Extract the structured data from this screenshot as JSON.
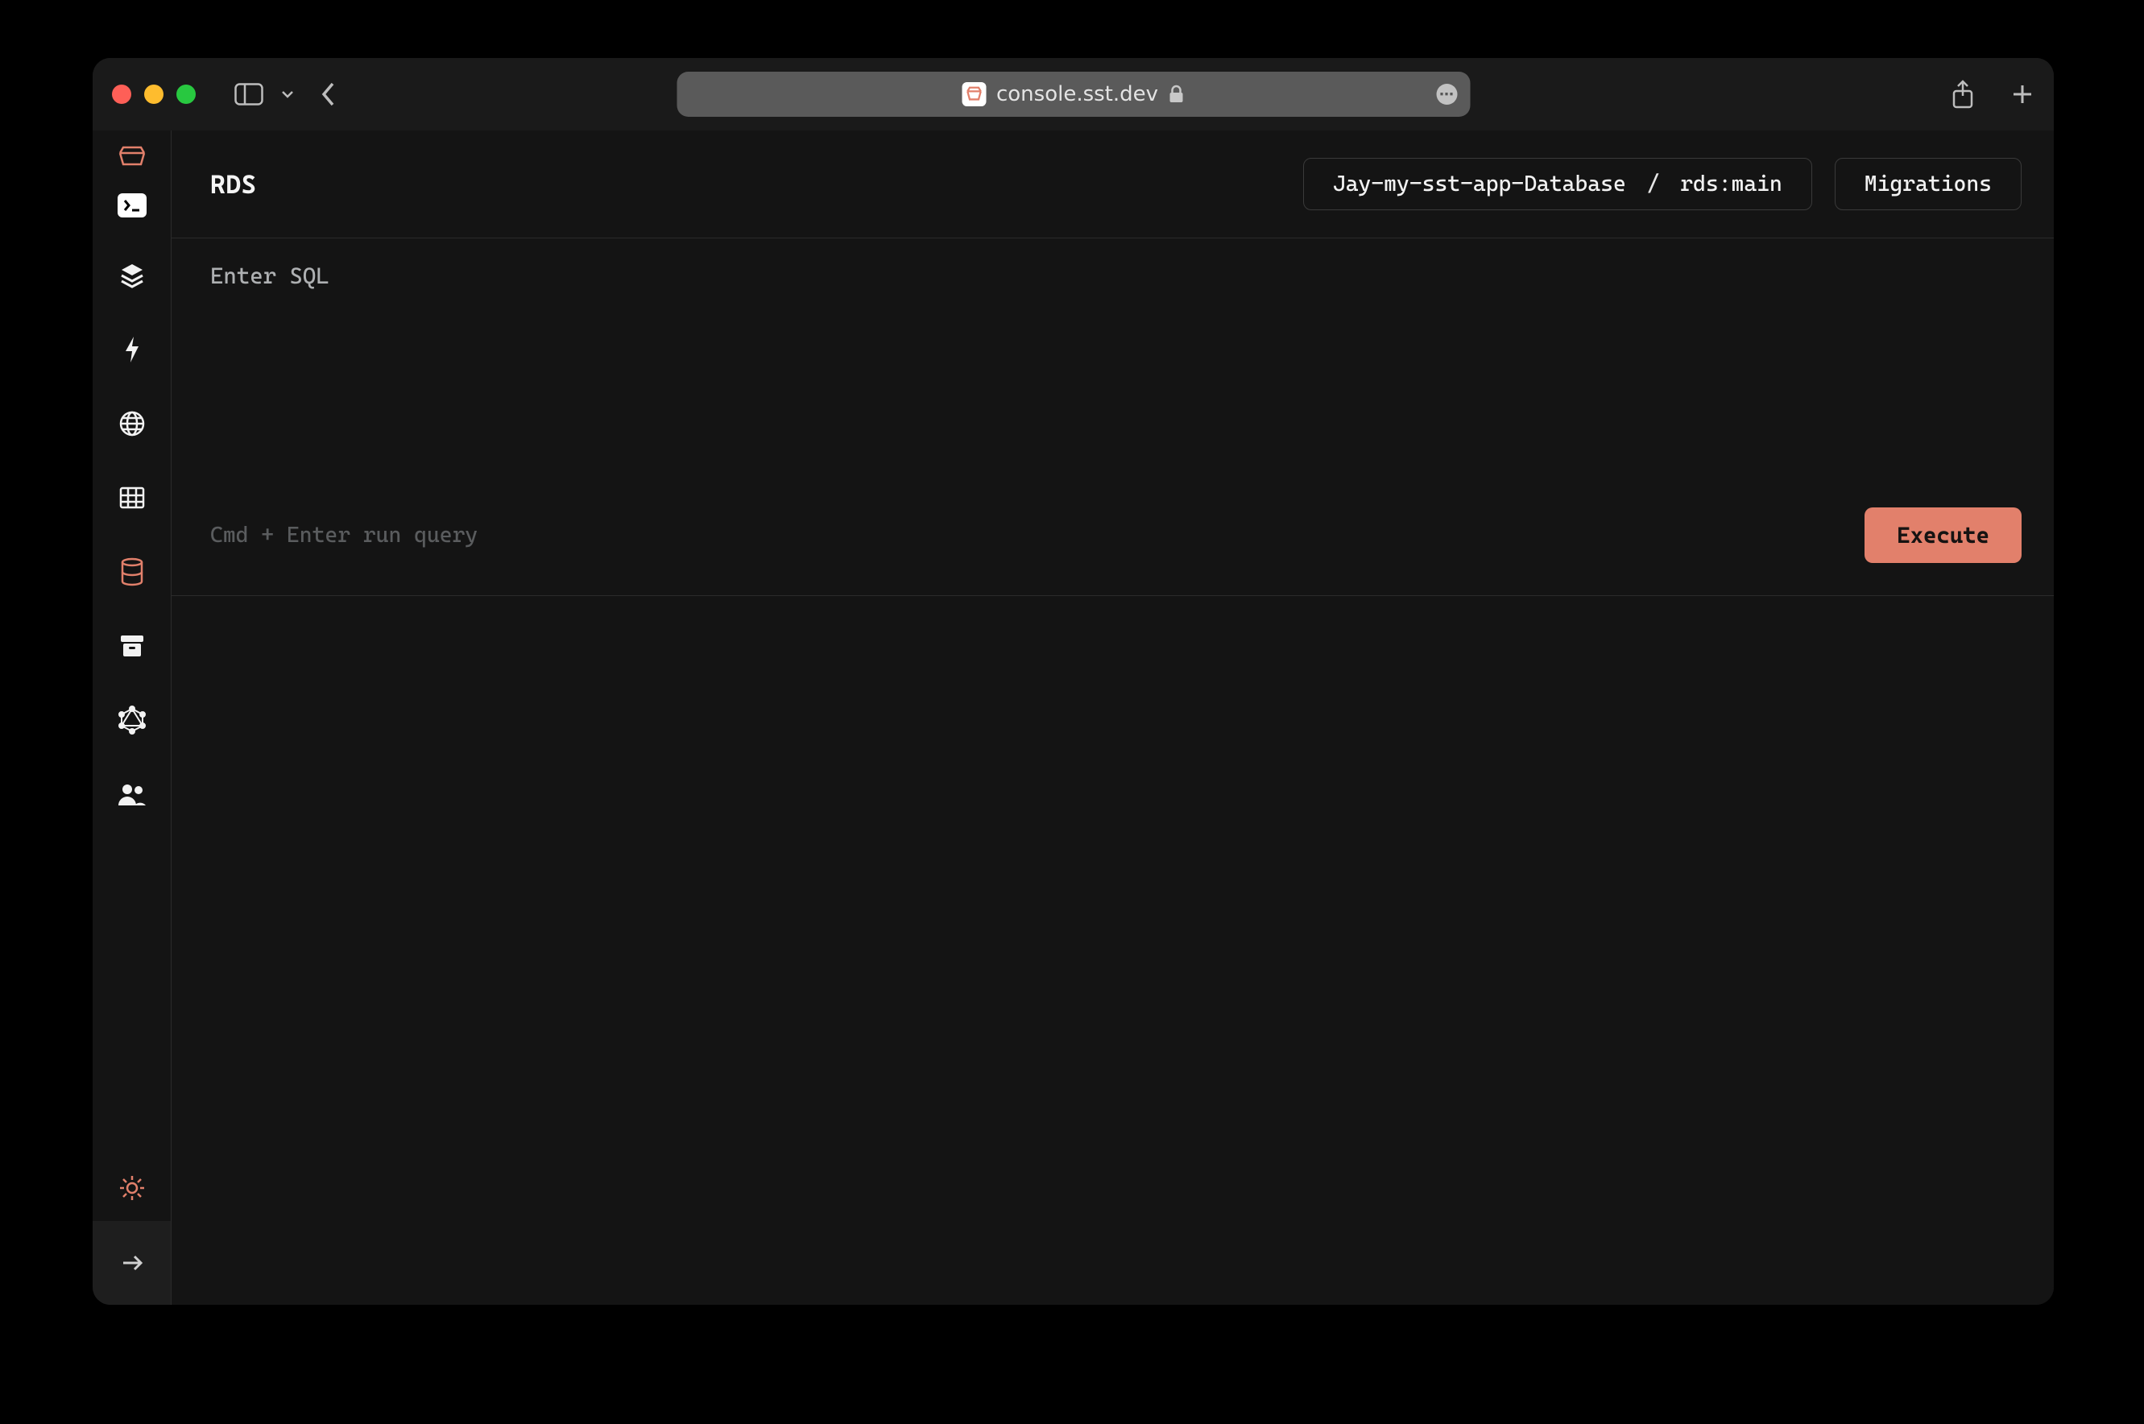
{
  "browser": {
    "address": "console.sst.dev"
  },
  "page": {
    "title": "RDS"
  },
  "header": {
    "db_selector": {
      "stack": "Jay-my-sst-app-Database",
      "resource": "rds:main"
    },
    "migrations_label": "Migrations"
  },
  "editor": {
    "placeholder": "Enter SQL",
    "value": "",
    "hint": "Cmd + Enter run query",
    "execute_label": "Execute"
  },
  "colors": {
    "accent": "#e2806b",
    "bg": "#141414",
    "border": "#2b2b2b"
  },
  "sidebar": {
    "items": [
      {
        "name": "local",
        "icon": "terminal-icon"
      },
      {
        "name": "stacks",
        "icon": "layers-icon"
      },
      {
        "name": "functions",
        "icon": "bolt-icon"
      },
      {
        "name": "api",
        "icon": "globe-icon"
      },
      {
        "name": "dynamodb",
        "icon": "table-icon"
      },
      {
        "name": "rds",
        "icon": "database-icon",
        "active": true
      },
      {
        "name": "buckets",
        "icon": "archive-icon"
      },
      {
        "name": "graphql",
        "icon": "graphql-icon"
      },
      {
        "name": "cognito",
        "icon": "users-icon"
      }
    ]
  }
}
